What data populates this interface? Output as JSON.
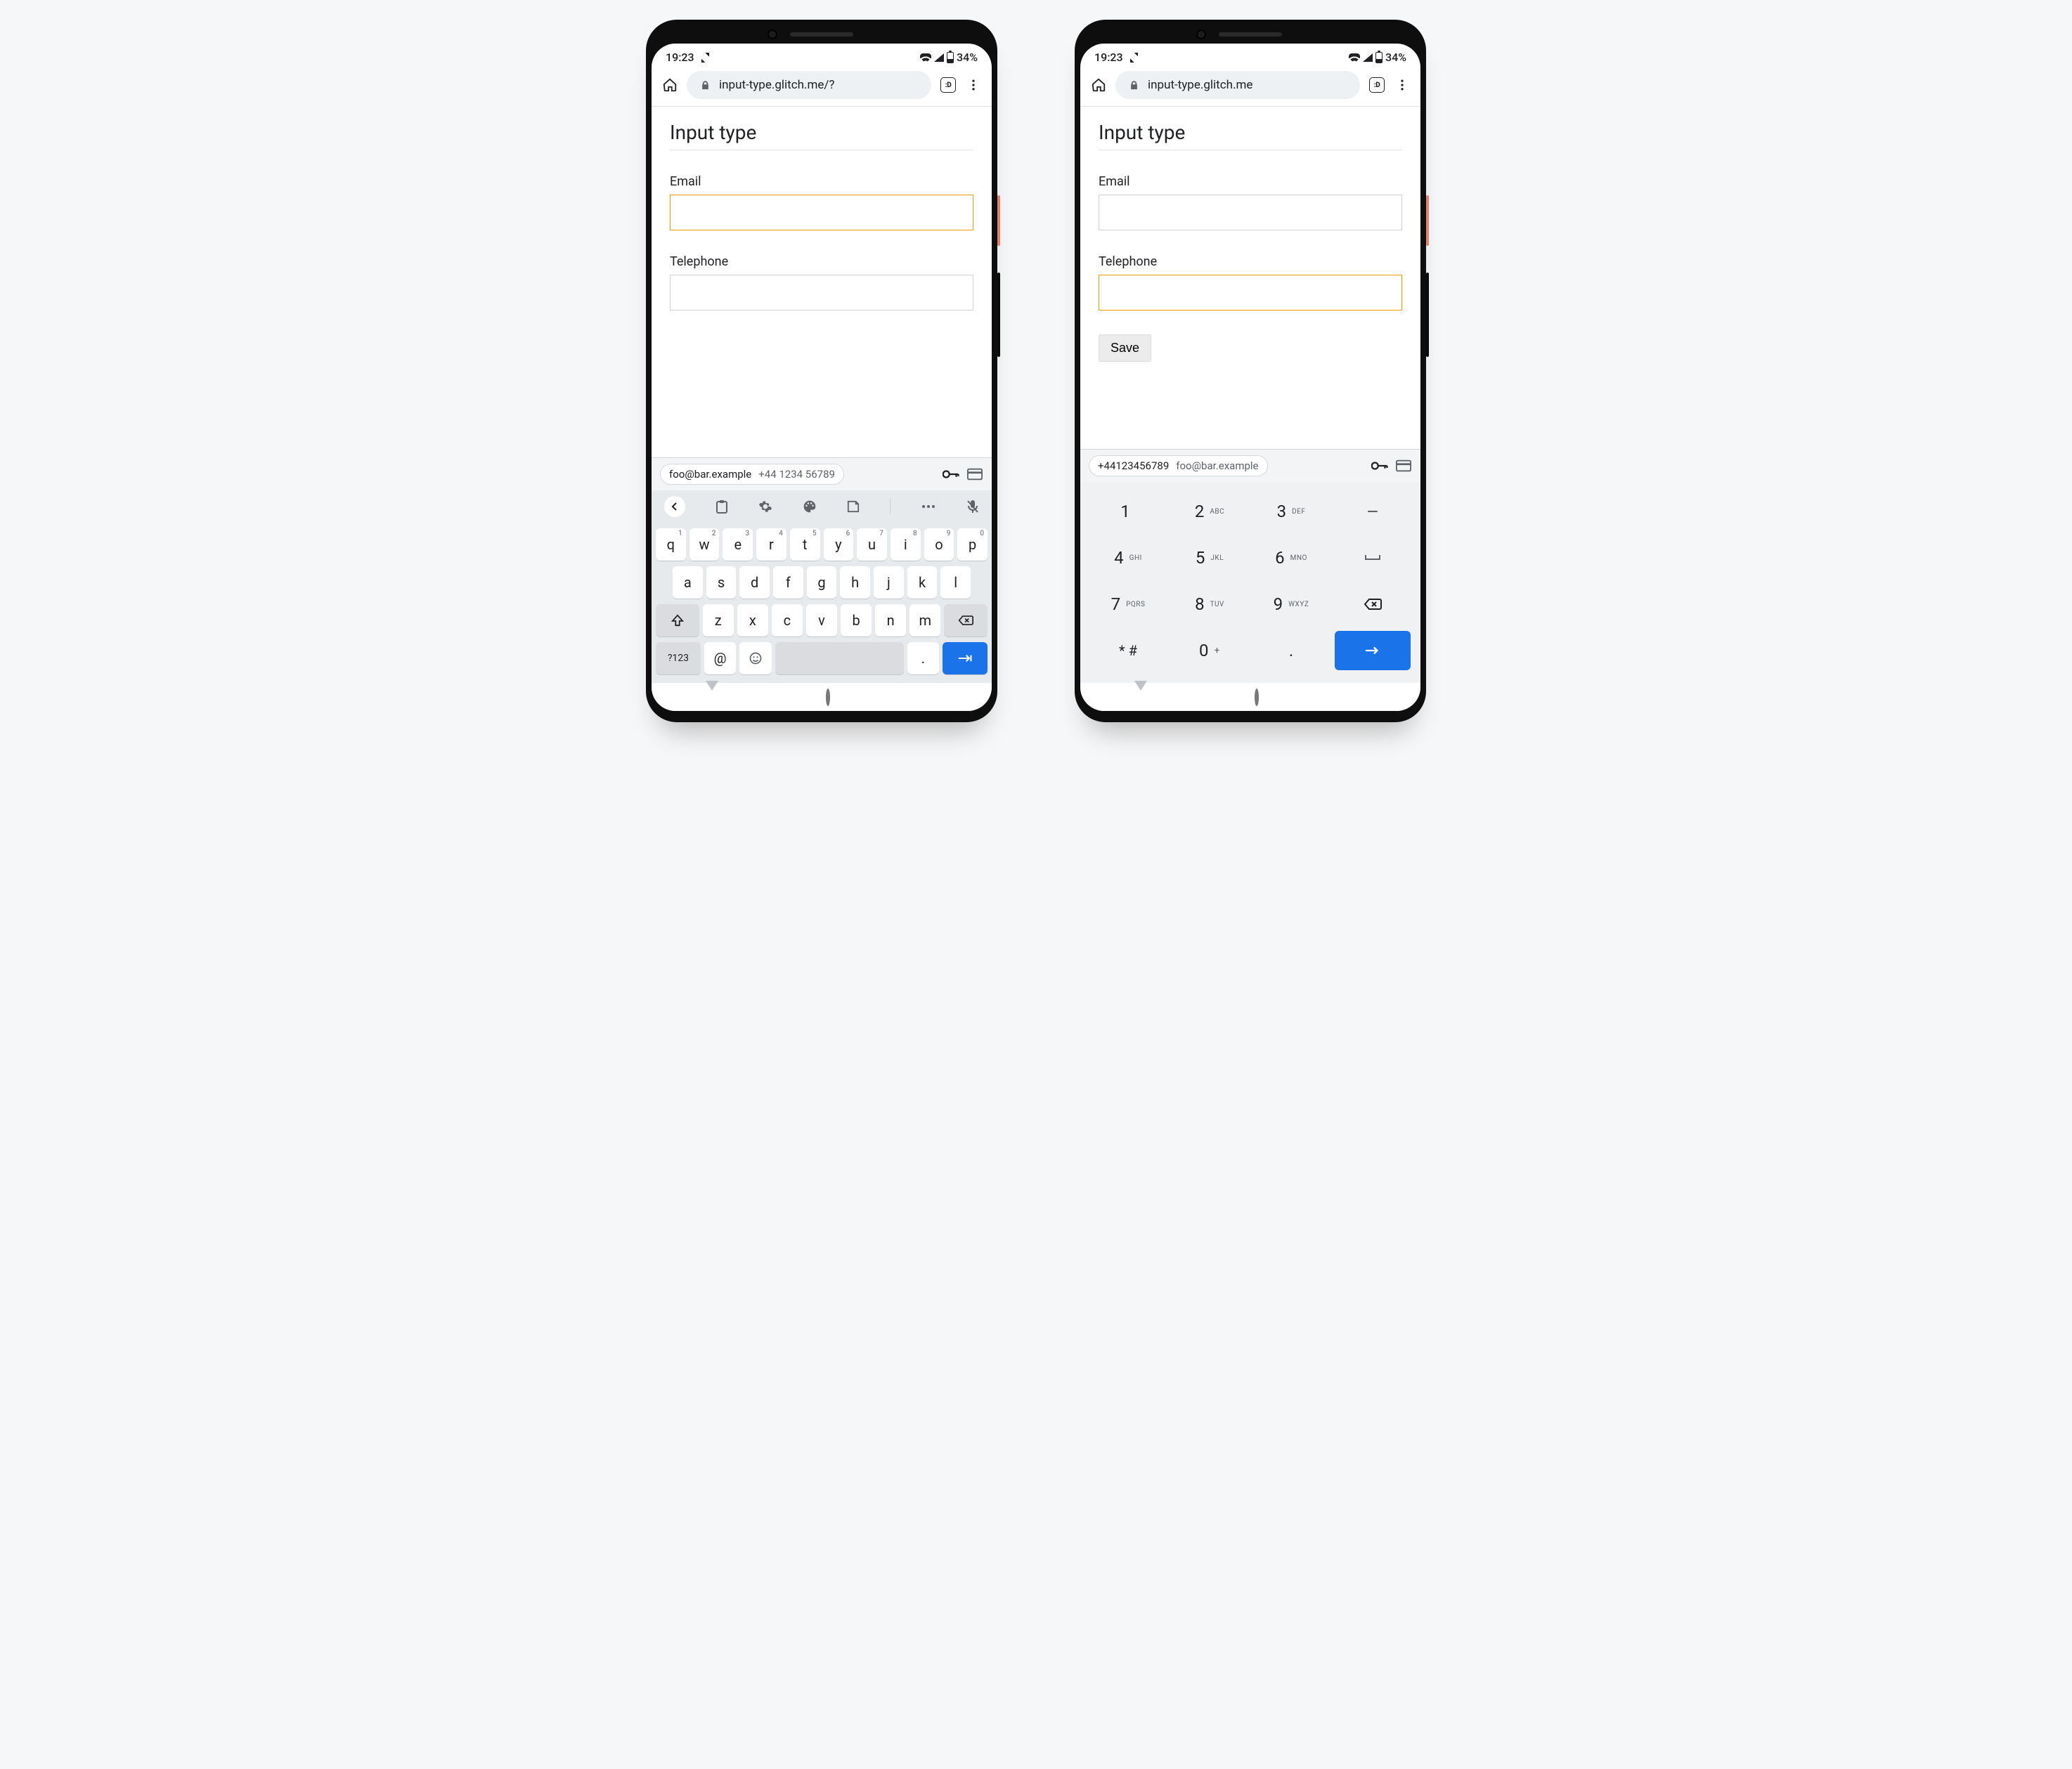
{
  "status": {
    "time": "19:23",
    "battery_pct": "34%"
  },
  "browser": {
    "left_url": "input-type.glitch.me/?",
    "right_url": "input-type.glitch.me",
    "tab_label": ":D"
  },
  "page": {
    "title": "Input type",
    "email_label": "Email",
    "telephone_label": "Telephone",
    "save_label": "Save"
  },
  "autofill": {
    "email": "foo@bar.example",
    "phone": "+44 1234 56789",
    "phone_compact": "+44123456789"
  },
  "qwerty": {
    "row1": [
      {
        "k": "q",
        "s": "1"
      },
      {
        "k": "w",
        "s": "2"
      },
      {
        "k": "e",
        "s": "3"
      },
      {
        "k": "r",
        "s": "4"
      },
      {
        "k": "t",
        "s": "5"
      },
      {
        "k": "y",
        "s": "6"
      },
      {
        "k": "u",
        "s": "7"
      },
      {
        "k": "i",
        "s": "8"
      },
      {
        "k": "o",
        "s": "9"
      },
      {
        "k": "p",
        "s": "0"
      }
    ],
    "row2": [
      "a",
      "s",
      "d",
      "f",
      "g",
      "h",
      "j",
      "k",
      "l"
    ],
    "row3": [
      "z",
      "x",
      "c",
      "v",
      "b",
      "n",
      "m"
    ],
    "sym_label": "?123",
    "at": "@",
    "period": "."
  },
  "numpad": {
    "row1": [
      {
        "n": "1",
        "l": ""
      },
      {
        "n": "2",
        "l": "ABC"
      },
      {
        "n": "3",
        "l": "DEF"
      }
    ],
    "row2": [
      {
        "n": "4",
        "l": "GHI"
      },
      {
        "n": "5",
        "l": "JKL"
      },
      {
        "n": "6",
        "l": "MNO"
      }
    ],
    "row3": [
      {
        "n": "7",
        "l": "PQRS"
      },
      {
        "n": "8",
        "l": "TUV"
      },
      {
        "n": "9",
        "l": "WXYZ"
      }
    ],
    "row4": [
      {
        "n": "* #",
        "l": ""
      },
      {
        "n": "0",
        "l": "+"
      },
      {
        "n": ".",
        "l": ""
      }
    ],
    "minus": "–",
    "space_glyph": "⎵"
  }
}
